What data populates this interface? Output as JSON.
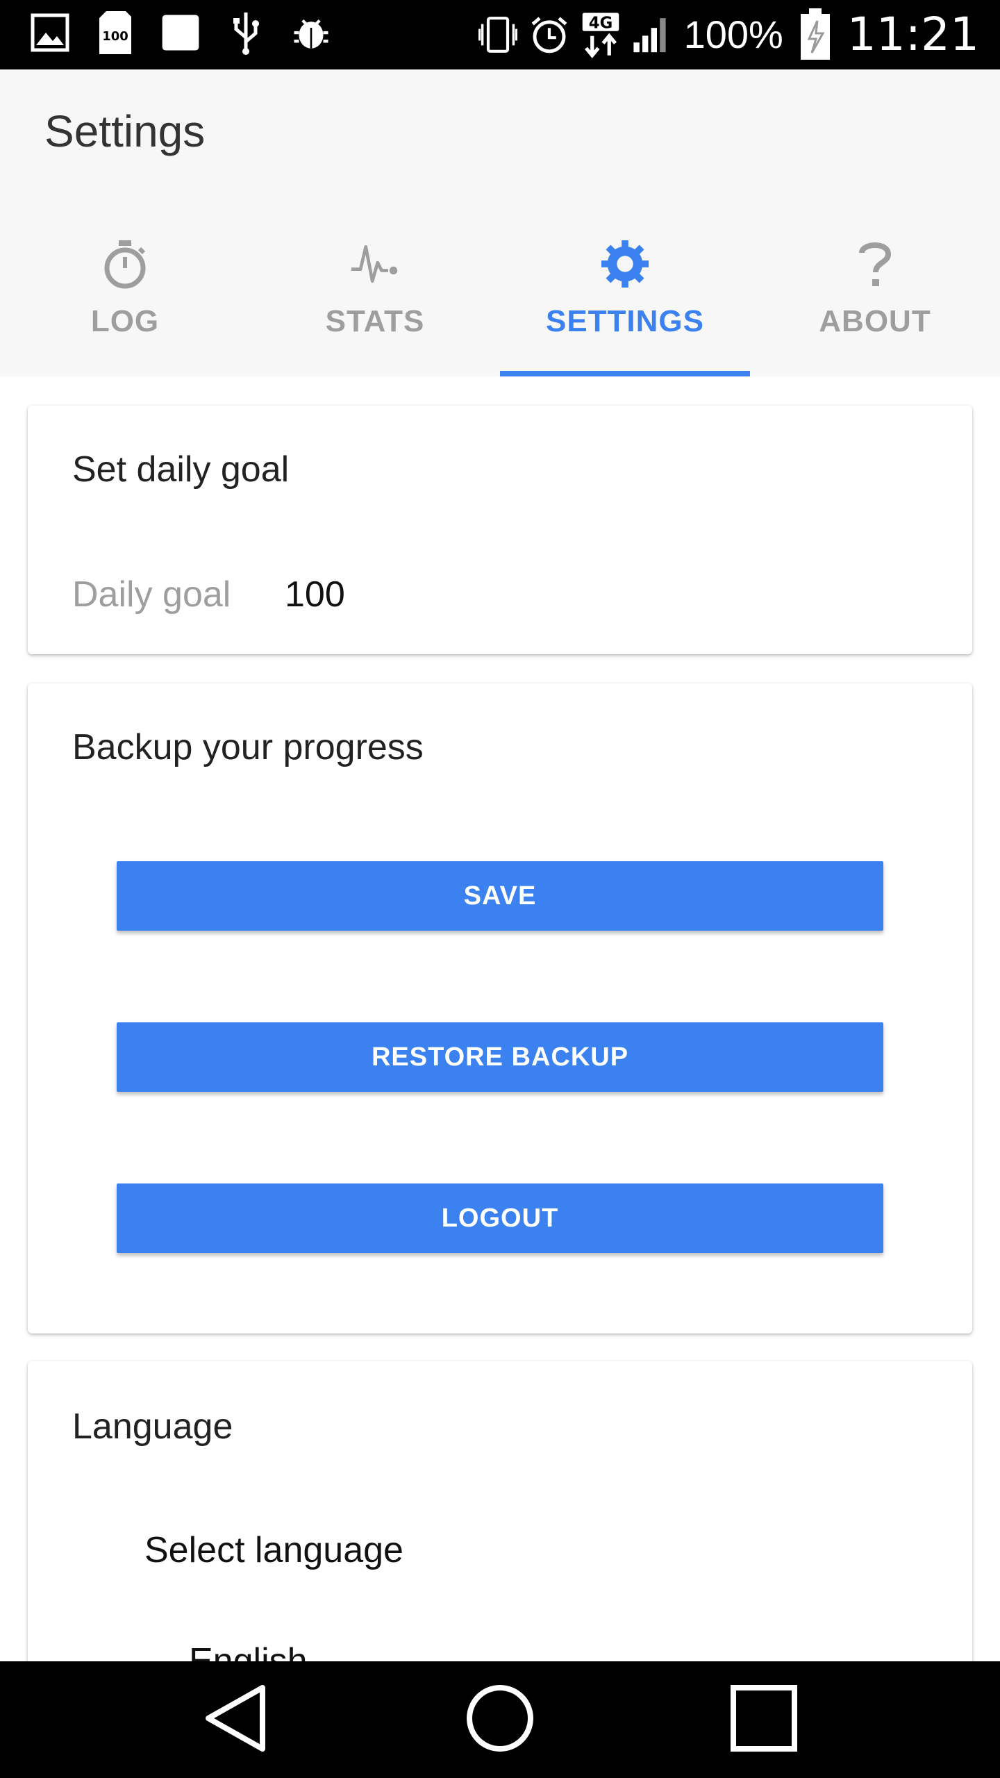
{
  "status_bar": {
    "battery_percent": "100%",
    "time": "11:21",
    "network": "4G",
    "icons": [
      "image-icon",
      "sd-card-icon",
      "blank-notification-icon",
      "usb-icon",
      "debug-bug-icon",
      "vibrate-icon",
      "alarm-icon",
      "network-4g-icon",
      "signal-icon",
      "battery-charging-icon"
    ]
  },
  "header": {
    "title": "Settings"
  },
  "tabs": [
    {
      "label": "LOG",
      "icon": "stopwatch-icon",
      "active": false
    },
    {
      "label": "STATS",
      "icon": "pulse-icon",
      "active": false
    },
    {
      "label": "SETTINGS",
      "icon": "gear-icon",
      "active": true
    },
    {
      "label": "ABOUT",
      "icon": "help-icon",
      "active": false
    }
  ],
  "daily_goal_card": {
    "title": "Set daily goal",
    "field_label": "Daily goal",
    "field_value": "100"
  },
  "backup_card": {
    "title": "Backup your progress",
    "buttons": {
      "save": "SAVE",
      "restore": "RESTORE BACKUP",
      "logout": "LOGOUT"
    }
  },
  "language_card": {
    "title": "Language",
    "select_label": "Select language",
    "selected_option": "English"
  },
  "colors": {
    "accent": "#3b82f0",
    "inactive_tab": "#9e9e9e",
    "header_bg": "#f7f7f7"
  }
}
